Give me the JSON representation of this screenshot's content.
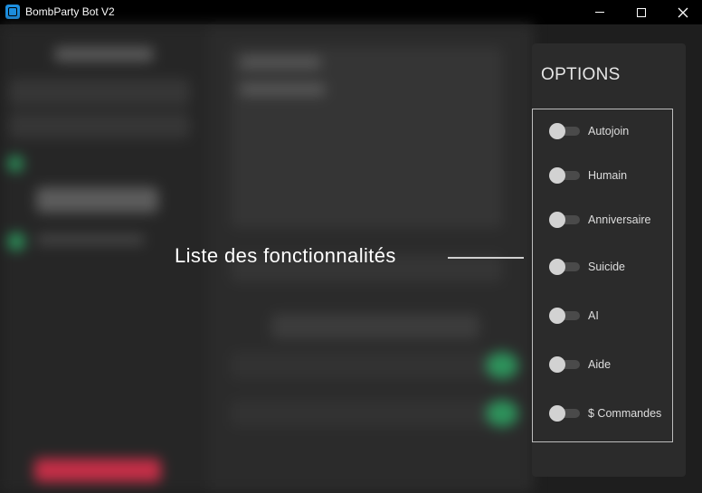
{
  "window": {
    "title": "BombParty Bot V2"
  },
  "options": {
    "title": "OPTIONS",
    "items": [
      {
        "label": "Autojoin",
        "enabled": false
      },
      {
        "label": "Humain",
        "enabled": false
      },
      {
        "label": "Anniversaire",
        "enabled": false
      },
      {
        "label": "Suicide",
        "enabled": false
      },
      {
        "label": "AI",
        "enabled": false
      },
      {
        "label": "Aide",
        "enabled": false
      },
      {
        "label": "$ Commandes",
        "enabled": false
      }
    ]
  },
  "annotation": {
    "text": "Liste des fonctionnalités"
  },
  "colors": {
    "accent_green": "#2fbf71",
    "accent_red": "#e0304e",
    "app_icon": "#1d8fe0"
  }
}
